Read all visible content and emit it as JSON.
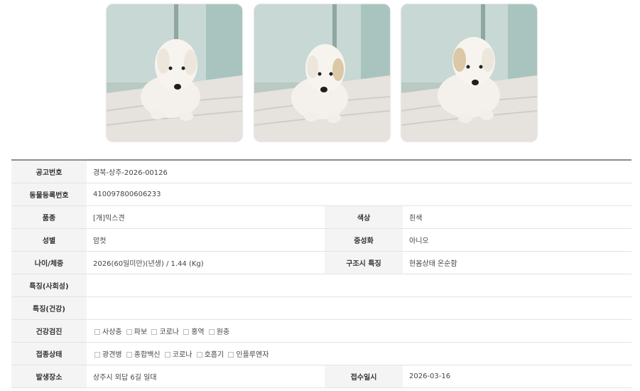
{
  "photos": [
    {
      "alt": "puppy-photo-1"
    },
    {
      "alt": "puppy-photo-2"
    },
    {
      "alt": "puppy-photo-3"
    }
  ],
  "details": {
    "notice_no_label": "공고번호",
    "notice_no": "경북-상주-2026-00126",
    "reg_no_label": "동물등록번호",
    "reg_no": "410097800606233",
    "breed_label": "품종",
    "breed": "[개]믹스견",
    "color_label": "색상",
    "color": "흰색",
    "sex_label": "성별",
    "sex": "암컷",
    "neuter_label": "중성화",
    "neuter": "아니오",
    "age_label": "나이/체중",
    "age": "2026(60일미만)(년생) / 1.44 (Kg)",
    "rescue_label": "구조시 특징",
    "rescue": "현몸상태 온순함",
    "social_label": "특징(사회성)",
    "social": "",
    "health_label": "특징(건강)",
    "health": "",
    "checkup_label": "건강검진",
    "checkup_items": [
      "사상충",
      "파보",
      "코로나",
      "홍역",
      "원충"
    ],
    "vaccine_label": "접종상태",
    "vaccine_items": [
      "광견병",
      "종합백신",
      "코로나",
      "호흡기",
      "인플루엔자"
    ],
    "place_label": "발생장소",
    "place": "상주시 외답 6길 일대",
    "date_label": "접수일시",
    "date": "2026-03-16"
  }
}
